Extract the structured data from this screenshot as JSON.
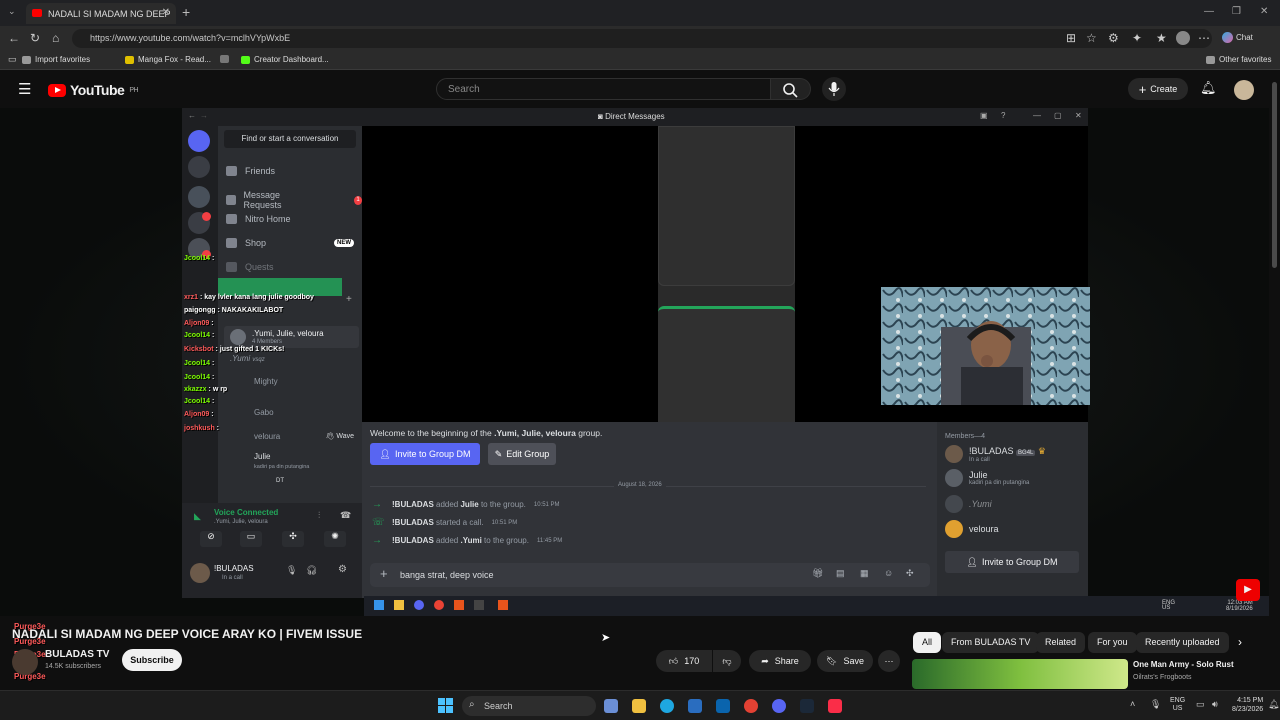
{
  "browser": {
    "tab_title": "NADALI SI MADAM NG DEEP",
    "url": "https://www.youtube.com/watch?v=mclhVYpWxbE",
    "bookmarks": [
      "Import favorites",
      "Manga Fox - Read...",
      "Creator Dashboard..."
    ],
    "other_favorites": "Other favorites",
    "chat_label": "Chat"
  },
  "youtube": {
    "logo_text": "YouTube",
    "region": "PH",
    "search_placeholder": "Search",
    "create_label": "Create"
  },
  "discord": {
    "window_title": "Direct Messages",
    "find_placeholder": "Find or start a conversation",
    "nav": [
      "Friends",
      "Message Requests",
      "Nitro Home",
      "Shop",
      "Quests"
    ],
    "message_requests_badge": "1",
    "shop_badge": "NEW",
    "dm_list": [
      {
        "name": ".Yumi, Julie, veloura",
        "sub": "4 Members"
      },
      {
        "name": ".Yumi",
        "sub": "vsqz"
      },
      {
        "name": "Mighty",
        "sub": ""
      },
      {
        "name": "Gabo",
        "sub": ""
      },
      {
        "name": "veloura",
        "sub": "Wave"
      },
      {
        "name": "Julie",
        "sub": "kadiri pa din putangina"
      },
      {
        "name": "",
        "sub": "DT"
      }
    ],
    "voice": {
      "status": "Voice Connected",
      "channel": ".Yumi, Julie, veloura"
    },
    "user": {
      "name": "!BULADAS",
      "status": "In a call"
    },
    "welcome_prefix": "Welcome to the beginning of the ",
    "welcome_group": ".Yumi, Julie, veloura",
    "welcome_suffix": " group.",
    "invite_label": "Invite to Group DM",
    "edit_group_label": "Edit Group",
    "date_divider": "August 18, 2026",
    "log": [
      {
        "actor": "!BULADAS",
        "action": " added ",
        "target": "Julie",
        "tail": " to the group.",
        "time": "10:51 PM"
      },
      {
        "actor": "!BULADAS",
        "action": " started a call.",
        "target": "",
        "tail": "",
        "time": "10:51 PM"
      },
      {
        "actor": "!BULADAS",
        "action": " added ",
        "target": ".Yumi",
        "tail": " to the group.",
        "time": "11:45 PM"
      }
    ],
    "message_input": "banga strat, deep voice",
    "members_header": "Members—4",
    "members": [
      {
        "name": "!BULADAS",
        "tag": "BG4L",
        "status": "In a call"
      },
      {
        "name": "Julie",
        "tag": "",
        "status": "kadiri pa din putangina"
      },
      {
        "name": ".Yumi",
        "tag": "",
        "status": ""
      },
      {
        "name": "veloura",
        "tag": "",
        "status": ""
      }
    ],
    "members_invite": "Invite to Group DM",
    "inner_clock": {
      "time": "12:03 AM",
      "date": "8/19/2026",
      "lang": "ENG",
      "region": "US"
    }
  },
  "overlay_chat": [
    {
      "user": "Jcool14",
      "msg": "",
      "color": "#7CFC00"
    },
    {
      "user": "xrz1",
      "msg": "kay lvler kana lang julie goodboy",
      "color": "#ff5a5a"
    },
    {
      "user": "paigongg",
      "msg": "NAKAKAKILABOT",
      "color": "#ffffff"
    },
    {
      "user": "Aljon09",
      "msg": "",
      "color": "#ff5a5a"
    },
    {
      "user": "Jcool14",
      "msg": "",
      "color": "#7CFC00"
    },
    {
      "user": "Kicksbot",
      "msg": "just gifted 1 KICKs!",
      "color": "#ff5a5a"
    },
    {
      "user": "Jcool14",
      "msg": "",
      "color": "#7CFC00"
    },
    {
      "user": "Jcool14",
      "msg": "",
      "color": "#7CFC00"
    },
    {
      "user": "xkazzx",
      "msg": "w rp",
      "color": "#7CFC00"
    },
    {
      "user": "Jcool14",
      "msg": "",
      "color": "#7CFC00"
    },
    {
      "user": "Aljon09",
      "msg": "",
      "color": "#ff5a5a"
    },
    {
      "user": "joshkush",
      "msg": "",
      "color": "#ff5a5a"
    }
  ],
  "left_overlay": [
    {
      "user": "Purge3e",
      "color": "#ff5a5a"
    },
    {
      "user": "Purge3e",
      "color": "#ff5a5a"
    },
    {
      "user": "Purge3e",
      "color": "#ff5a5a"
    },
    {
      "user": "Purge3e",
      "color": "#ff5a5a"
    },
    {
      "user": "reMRT201",
      "color": "#ff5a5a"
    },
    {
      "user": "Purge3e",
      "color": "#ff5a5a"
    }
  ],
  "video": {
    "title": "NADALI SI MADAM NG DEEP VOICE ARAY KO | FIVEM ISSUE",
    "channel": "BULADAS TV",
    "subscribers": "14.5K subscribers",
    "subscribe_label": "Subscribe",
    "likes": "170",
    "share_label": "Share",
    "save_label": "Save"
  },
  "chips": [
    "All",
    "From BULADAS TV",
    "Related",
    "For you",
    "Recently uploaded"
  ],
  "recommendation": {
    "title": "One Man Army - Solo Rust",
    "channel": "Oilrats's Frogboots"
  },
  "taskbar": {
    "search_placeholder": "Search",
    "lang": "ENG",
    "region": "US",
    "time": "4:15 PM",
    "date": "8/23/2026"
  },
  "colors": {
    "yt_red": "#ff0000",
    "discord_blurple": "#5865f2",
    "discord_green": "#23a55a"
  }
}
